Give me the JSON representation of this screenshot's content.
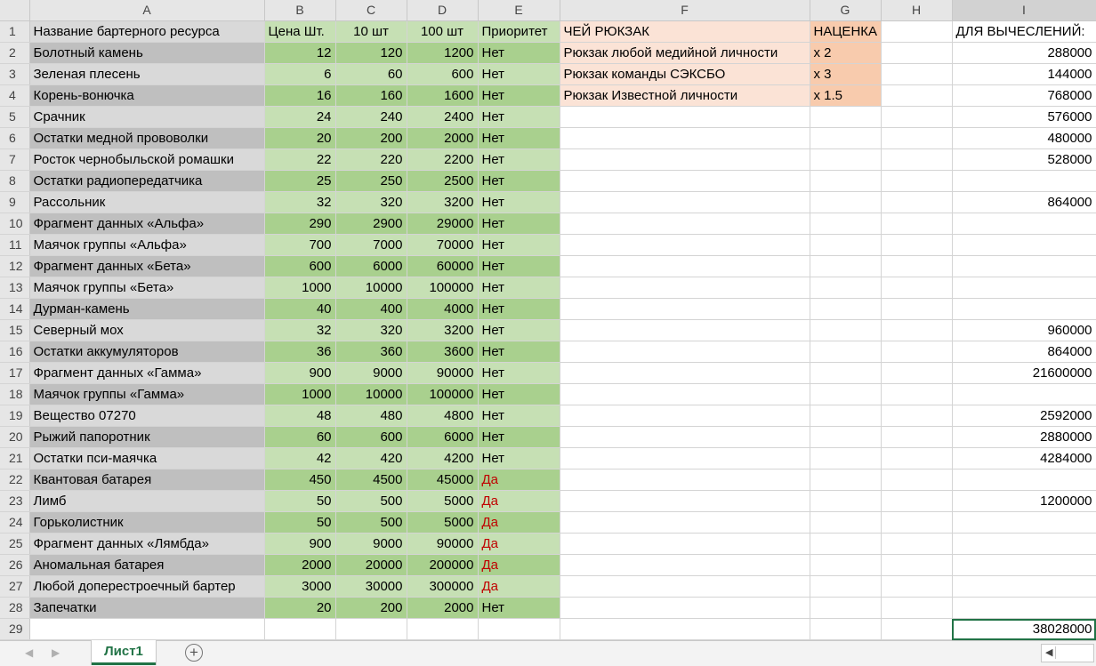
{
  "columns": [
    "A",
    "B",
    "C",
    "D",
    "E",
    "F",
    "G",
    "H",
    "I"
  ],
  "row_numbers": [
    "1",
    "2",
    "3",
    "4",
    "5",
    "6",
    "7",
    "8",
    "9",
    "10",
    "11",
    "12",
    "13",
    "14",
    "15",
    "16",
    "17",
    "18",
    "19",
    "20",
    "21",
    "22",
    "23",
    "24",
    "25",
    "26",
    "27",
    "28",
    "29"
  ],
  "header_row": {
    "a": "Название бартерного ресурса",
    "b": "Цена Шт.",
    "c": "10 шт",
    "d": "100 шт",
    "e": "Приоритет",
    "f": "ЧЕЙ РЮКЗАК",
    "g": "НАЦЕНКА",
    "i": "ДЛЯ ВЫЧЕСЛЕНИЙ:"
  },
  "rows": [
    {
      "name": "Болотный камень",
      "price": "12",
      "ten": "120",
      "hundred": "1200",
      "priority": "Нет",
      "backpack": "Рюкзак любой медийной личности",
      "markup": "x 2",
      "calc": "288000"
    },
    {
      "name": "Зеленая плесень",
      "price": "6",
      "ten": "60",
      "hundred": "600",
      "priority": "Нет",
      "backpack": "Рюкзак команды СЭКСБО",
      "markup": "x 3",
      "calc": "144000"
    },
    {
      "name": "Корень-вонючка",
      "price": "16",
      "ten": "160",
      "hundred": "1600",
      "priority": "Нет",
      "backpack": "Рюкзак Известной личности",
      "markup": "x 1.5",
      "calc": "768000"
    },
    {
      "name": "Срачник",
      "price": "24",
      "ten": "240",
      "hundred": "2400",
      "priority": "Нет",
      "backpack": "",
      "markup": "",
      "calc": "576000"
    },
    {
      "name": "Остатки медной прововолки",
      "price": "20",
      "ten": "200",
      "hundred": "2000",
      "priority": "Нет",
      "backpack": "",
      "markup": "",
      "calc": "480000"
    },
    {
      "name": "Росток чернобыльской ромашки",
      "price": "22",
      "ten": "220",
      "hundred": "2200",
      "priority": "Нет",
      "backpack": "",
      "markup": "",
      "calc": "528000"
    },
    {
      "name": "Остатки радиопередатчика",
      "price": "25",
      "ten": "250",
      "hundred": "2500",
      "priority": "Нет",
      "backpack": "",
      "markup": "",
      "calc": ""
    },
    {
      "name": "Рассольник",
      "price": "32",
      "ten": "320",
      "hundred": "3200",
      "priority": "Нет",
      "backpack": "",
      "markup": "",
      "calc": "864000"
    },
    {
      "name": "Фрагмент данных «Альфа»",
      "price": "290",
      "ten": "2900",
      "hundred": "29000",
      "priority": "Нет",
      "backpack": "",
      "markup": "",
      "calc": ""
    },
    {
      "name": "Маячок группы «Альфа»",
      "price": "700",
      "ten": "7000",
      "hundred": "70000",
      "priority": "Нет",
      "backpack": "",
      "markup": "",
      "calc": ""
    },
    {
      "name": "Фрагмент данных «Бета»",
      "price": "600",
      "ten": "6000",
      "hundred": "60000",
      "priority": "Нет",
      "backpack": "",
      "markup": "",
      "calc": ""
    },
    {
      "name": "Маячок группы «Бета»",
      "price": "1000",
      "ten": "10000",
      "hundred": "100000",
      "priority": "Нет",
      "backpack": "",
      "markup": "",
      "calc": ""
    },
    {
      "name": "Дурман-камень",
      "price": "40",
      "ten": "400",
      "hundred": "4000",
      "priority": "Нет",
      "backpack": "",
      "markup": "",
      "calc": ""
    },
    {
      "name": "Северный мох",
      "price": "32",
      "ten": "320",
      "hundred": "3200",
      "priority": "Нет",
      "backpack": "",
      "markup": "",
      "calc": "960000"
    },
    {
      "name": "Остатки аккумуляторов",
      "price": "36",
      "ten": "360",
      "hundred": "3600",
      "priority": "Нет",
      "backpack": "",
      "markup": "",
      "calc": "864000"
    },
    {
      "name": "Фрагмент данных «Гамма»",
      "price": "900",
      "ten": "9000",
      "hundred": "90000",
      "priority": "Нет",
      "backpack": "",
      "markup": "",
      "calc": "21600000"
    },
    {
      "name": "Маячок группы «Гамма»",
      "price": "1000",
      "ten": "10000",
      "hundred": "100000",
      "priority": "Нет",
      "backpack": "",
      "markup": "",
      "calc": ""
    },
    {
      "name": "Вещество 07270",
      "price": "48",
      "ten": "480",
      "hundred": "4800",
      "priority": "Нет",
      "backpack": "",
      "markup": "",
      "calc": "2592000"
    },
    {
      "name": "Рыжий папоротник",
      "price": "60",
      "ten": "600",
      "hundred": "6000",
      "priority": "Нет",
      "backpack": "",
      "markup": "",
      "calc": "2880000"
    },
    {
      "name": "Остатки пси-маячка",
      "price": "42",
      "ten": "420",
      "hundred": "4200",
      "priority": "Нет",
      "backpack": "",
      "markup": "",
      "calc": "4284000"
    },
    {
      "name": "Квантовая батарея",
      "price": "450",
      "ten": "4500",
      "hundred": "45000",
      "priority": "Да",
      "backpack": "",
      "markup": "",
      "calc": ""
    },
    {
      "name": "Лимб",
      "price": "50",
      "ten": "500",
      "hundred": "5000",
      "priority": "Да",
      "backpack": "",
      "markup": "",
      "calc": "1200000"
    },
    {
      "name": "Горьколистник",
      "price": "50",
      "ten": "500",
      "hundred": "5000",
      "priority": "Да",
      "backpack": "",
      "markup": "",
      "calc": ""
    },
    {
      "name": "Фрагмент данных «Лямбда»",
      "price": "900",
      "ten": "9000",
      "hundred": "90000",
      "priority": "Да",
      "backpack": "",
      "markup": "",
      "calc": ""
    },
    {
      "name": "Аномальная батарея",
      "price": "2000",
      "ten": "20000",
      "hundred": "200000",
      "priority": "Да",
      "backpack": "",
      "markup": "",
      "calc": ""
    },
    {
      "name": "Любой доперестроечный бартер",
      "price": "3000",
      "ten": "30000",
      "hundred": "300000",
      "priority": "Да",
      "backpack": "",
      "markup": "",
      "calc": ""
    },
    {
      "name": "Запечатки",
      "price": "20",
      "ten": "200",
      "hundred": "2000",
      "priority": "Нет",
      "backpack": "",
      "markup": "",
      "calc": ""
    }
  ],
  "total_row": {
    "calc": "38028000"
  },
  "priority_colors": {
    "yes": "#c00000",
    "no": "#000000"
  },
  "sheet_tab": "Лист1",
  "accent_color": "#217346"
}
